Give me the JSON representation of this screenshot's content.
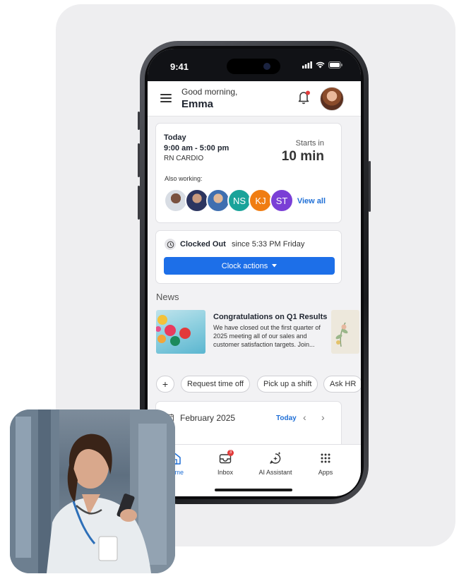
{
  "status_bar": {
    "time": "9:41"
  },
  "header": {
    "greeting": "Good morning,",
    "user_name": "Emma"
  },
  "shift_card": {
    "day_label": "Today",
    "hours": "9:00 am - 5:00 pm",
    "role": "RN CARDIO",
    "starts_label": "Starts in",
    "starts_value": "10 min",
    "also_working_label": "Also working:",
    "coworkers": [
      {
        "initials": "",
        "color": "#6b5a4e"
      },
      {
        "initials": "",
        "color": "#3b4a7a"
      },
      {
        "initials": "",
        "color": "#8aa4c8"
      },
      {
        "initials": "NS",
        "color": "#1aa39a"
      },
      {
        "initials": "KJ",
        "color": "#f07d12"
      },
      {
        "initials": "ST",
        "color": "#7a3fd6"
      }
    ],
    "view_all_label": "View all"
  },
  "clock_card": {
    "state": "Clocked Out",
    "since": "since 5:33 PM Friday",
    "button_label": "Clock actions"
  },
  "news": {
    "section_title": "News",
    "items": [
      {
        "headline": "Congratulations on Q1 Results",
        "body": "We have closed out the first quarter of 2025 meeting all of our sales and customer satisfaction targets. Join..."
      }
    ]
  },
  "quick_actions": {
    "add_label": "+",
    "chips": [
      "Request time off",
      "Pick up a shift",
      "Ask HR"
    ]
  },
  "calendar": {
    "month": "February 2025",
    "today_label": "Today",
    "prev_label": "‹",
    "next_label": "›"
  },
  "tabbar": {
    "tabs": [
      {
        "label": "Home",
        "icon": "home-icon",
        "active": true
      },
      {
        "label": "Inbox",
        "icon": "inbox-icon",
        "badge": "3"
      },
      {
        "label": "AI Assistant",
        "icon": "ai-assistant-icon"
      },
      {
        "label": "Apps",
        "icon": "apps-grid-icon"
      }
    ]
  },
  "colors": {
    "accent": "#1d6fe8",
    "link": "#1f6fd6",
    "notification": "#e23b3b"
  }
}
